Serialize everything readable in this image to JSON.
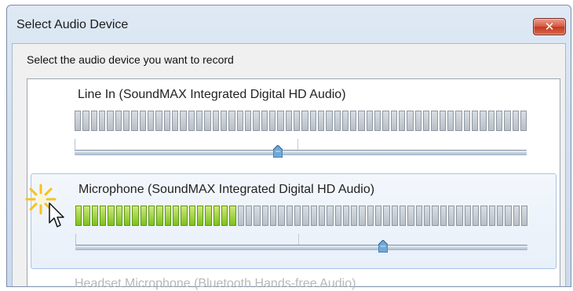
{
  "window": {
    "title": "Select Audio Device",
    "close_symbol": "✕"
  },
  "instruction": "Select the audio device you want to record",
  "devices": [
    {
      "name": "Line In (SoundMAX Integrated Digital HD Audio)",
      "level_segments_lit": 0,
      "volume": 0.45,
      "selected": false
    },
    {
      "name": "Microphone (SoundMAX Integrated Digital HD Audio)",
      "level_segments_lit": 20,
      "volume": 0.68,
      "selected": true
    },
    {
      "name": "Headset Microphone (Bluetooth Hands-free Audio)",
      "selected": false
    }
  ],
  "meter_total_segments": 56,
  "colors": {
    "meter_on": "#7cc21b",
    "thumb": "#6fa8d8",
    "selection": "#e8f0fa"
  },
  "icons": [
    "close-icon",
    "slider-thumb-icon",
    "mouse-pointer-icon",
    "click-burst-icon"
  ]
}
